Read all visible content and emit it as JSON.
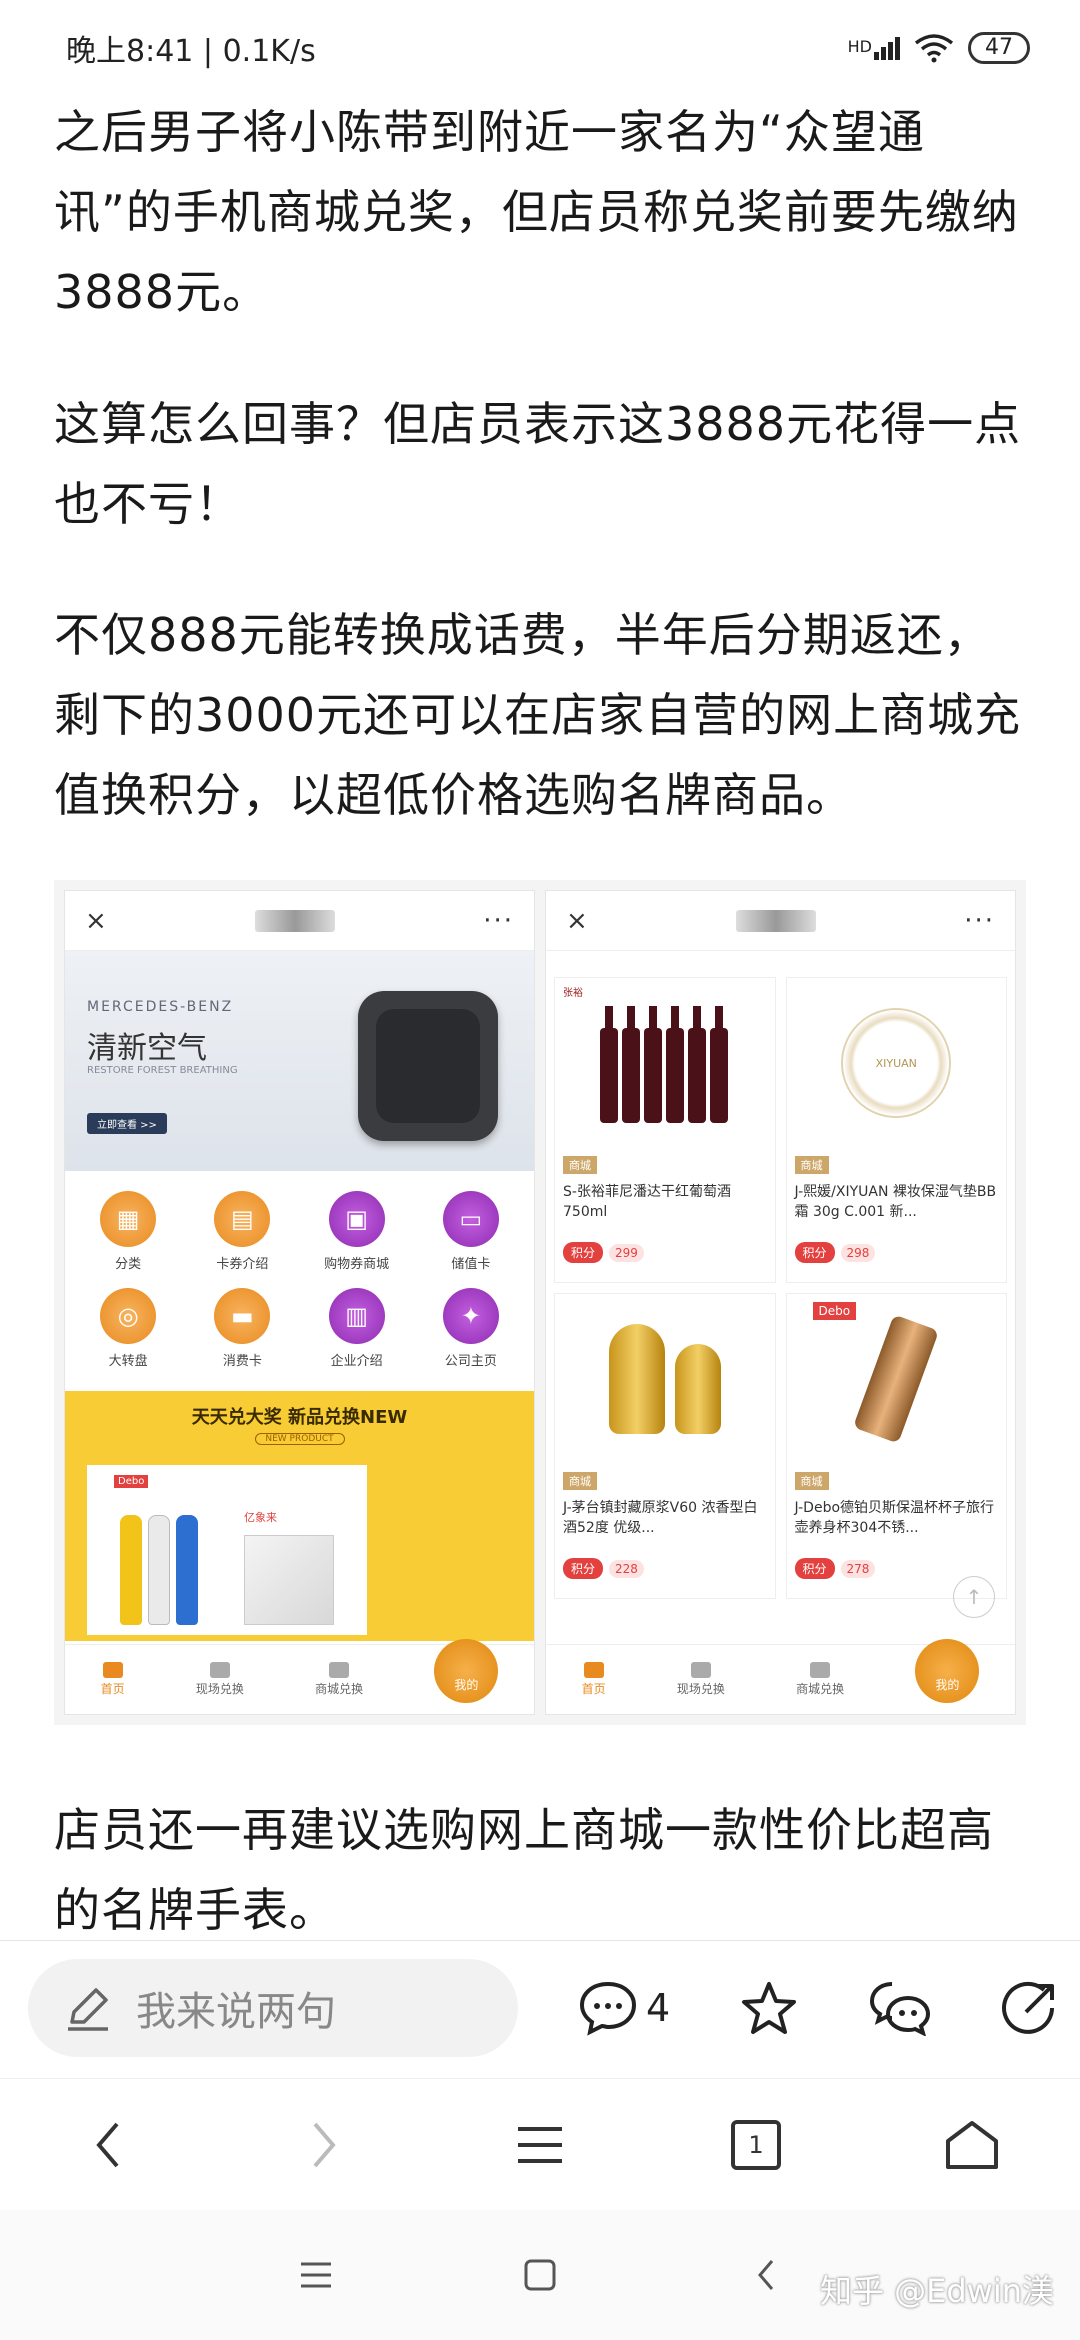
{
  "status_bar": {
    "time": "晚上8:41",
    "net_speed": "0.1K/s",
    "signal_label": "HD",
    "battery": "47"
  },
  "article": {
    "paragraphs": [
      "之后男子将小陈带到附近一家名为“众望通讯”的手机商城兑奖，但店员称兑奖前要先缴纳3888元。",
      "这算怎么回事？但店员表示这3888元花得一点也不亏！",
      "不仅888元能转换成话费，半年后分期返还，剩下的3000元还可以在店家自营的网上商城充值换积分，以超低价格选购名牌商品。",
      "店员还一再建议选购网上商城一款性价比超高的名牌手表。"
    ]
  },
  "left_phone": {
    "close": "×",
    "more": "···",
    "banner": {
      "brand": "MERCEDES-BENZ",
      "title": "清新空气",
      "subtitle": "RESTORE FOREST BREATHING",
      "button": "立即查看 >>"
    },
    "grid": [
      {
        "label": "分类",
        "icon": "category-icon",
        "color": "#e88a1f"
      },
      {
        "label": "卡券介绍",
        "icon": "coupon-icon",
        "color": "#e88a1f"
      },
      {
        "label": "购物券商城",
        "icon": "shopping-mall-icon",
        "color": "#8d2bb0"
      },
      {
        "label": "储值卡",
        "icon": "stored-value-card-icon",
        "color": "#8d2bb0"
      },
      {
        "label": "大转盘",
        "icon": "wheel-icon",
        "color": "#e88a1f"
      },
      {
        "label": "消费卡",
        "icon": "consumer-card-icon",
        "color": "#e88a1f"
      },
      {
        "label": "企业介绍",
        "icon": "company-icon",
        "color": "#8d2bb0"
      },
      {
        "label": "公司主页",
        "icon": "homepage-icon",
        "color": "#8d2bb0"
      }
    ],
    "promo": {
      "title": "天天兑大奖 新品兑换NEW",
      "subtitle": "NEW PRODUCT",
      "brand_a": "Debo",
      "brand_b": "亿象来"
    },
    "tabs": [
      "首页",
      "现场兑换",
      "商城兑换",
      "我的"
    ]
  },
  "right_phone": {
    "close": "×",
    "more": "···",
    "products": [
      {
        "image_label": "张裕",
        "tag": "商城",
        "name": "S-张裕菲尼潘达干红葡萄酒750ml",
        "points_label": "积分",
        "points": "299"
      },
      {
        "image_label": "XIYUAN",
        "tag": "商城",
        "name": "J-熙媛/XIYUAN 裸妆保湿气垫BB霜 30g C.001 新...",
        "points_label": "积分",
        "points": "298"
      },
      {
        "image_label": "",
        "tag": "商城",
        "name": "J-茅台镇封藏原浆V60 浓香型白酒52度 优级...",
        "points_label": "积分",
        "points": "228"
      },
      {
        "image_label": "Debo",
        "tag": "商城",
        "name": "J-Debo德铂贝斯保温杯杯子旅行壶养身杯304不锈...",
        "points_label": "积分",
        "points": "278"
      }
    ],
    "tabs": [
      "首页",
      "现场兑换",
      "商城兑换",
      "我的"
    ]
  },
  "comment_bar": {
    "placeholder": "我来说两句",
    "comment_count": "4"
  },
  "browser_nav": {
    "tab_count": "1"
  },
  "watermark": "知乎 @Edwin渼"
}
